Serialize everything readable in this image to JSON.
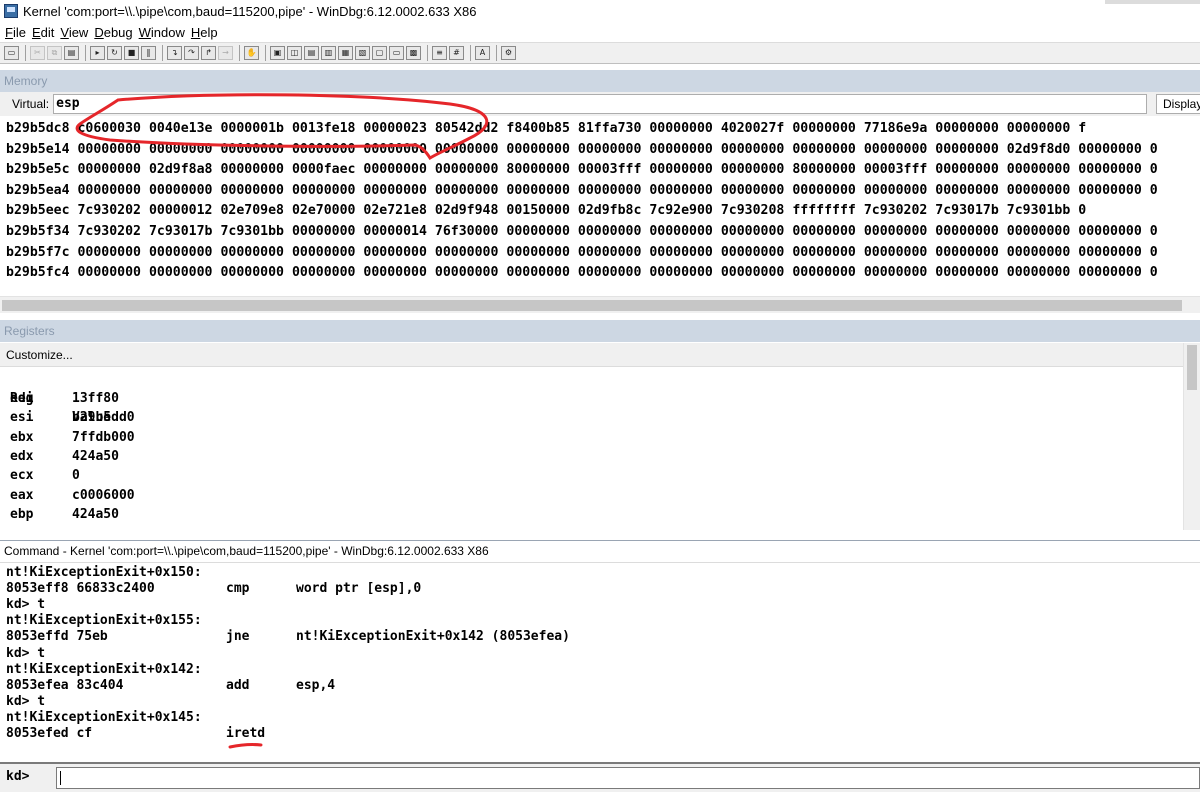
{
  "window": {
    "title": "Kernel 'com:port=\\\\.\\pipe\\com,baud=115200,pipe' - WinDbg:6.12.0002.633 X86"
  },
  "menu": [
    {
      "accel": "F",
      "rest": "ile"
    },
    {
      "accel": "E",
      "rest": "dit"
    },
    {
      "accel": "V",
      "rest": "iew"
    },
    {
      "accel": "D",
      "rest": "ebug"
    },
    {
      "accel": "W",
      "rest": "indow"
    },
    {
      "accel": "H",
      "rest": "elp"
    }
  ],
  "memory": {
    "header": "Memory",
    "virtual_label": "Virtual:",
    "virtual_value": "esp",
    "display_label": "Display",
    "rows": [
      {
        "addr": "b29b5dc8",
        "words": [
          "c0600030",
          "0040e13e",
          "0000001b",
          "0013fe18",
          "00000023",
          "80542dd2",
          "f8400b85",
          "81ffa730",
          "00000000",
          "4020027f",
          "00000000",
          "77186e9a",
          "00000000",
          "00000000",
          "f"
        ]
      },
      {
        "addr": "b29b5e14",
        "words": [
          "00000000",
          "00000000",
          "00000000",
          "00000000",
          "00000000",
          "00000000",
          "00000000",
          "00000000",
          "00000000",
          "00000000",
          "00000000",
          "00000000",
          "00000000",
          "02d9f8d0",
          "00000000",
          "0"
        ]
      },
      {
        "addr": "b29b5e5c",
        "words": [
          "00000000",
          "02d9f8a8",
          "00000000",
          "0000faec",
          "00000000",
          "00000000",
          "80000000",
          "00003fff",
          "00000000",
          "00000000",
          "80000000",
          "00003fff",
          "00000000",
          "00000000",
          "00000000",
          "0"
        ]
      },
      {
        "addr": "b29b5ea4",
        "words": [
          "00000000",
          "00000000",
          "00000000",
          "00000000",
          "00000000",
          "00000000",
          "00000000",
          "00000000",
          "00000000",
          "00000000",
          "00000000",
          "00000000",
          "00000000",
          "00000000",
          "00000000",
          "0"
        ]
      },
      {
        "addr": "b29b5eec",
        "words": [
          "7c930202",
          "00000012",
          "02e709e8",
          "02e70000",
          "02e721e8",
          "02d9f948",
          "00150000",
          "02d9fb8c",
          "7c92e900",
          "7c930208",
          "ffffffff",
          "7c930202",
          "7c93017b",
          "7c9301bb",
          "0"
        ]
      },
      {
        "addr": "b29b5f34",
        "words": [
          "7c930202",
          "7c93017b",
          "7c9301bb",
          "00000000",
          "00000014",
          "76f30000",
          "00000000",
          "00000000",
          "00000000",
          "00000000",
          "00000000",
          "00000000",
          "00000000",
          "00000000",
          "00000000",
          "0"
        ]
      },
      {
        "addr": "b29b5f7c",
        "words": [
          "00000000",
          "00000000",
          "00000000",
          "00000000",
          "00000000",
          "00000000",
          "00000000",
          "00000000",
          "00000000",
          "00000000",
          "00000000",
          "00000000",
          "00000000",
          "00000000",
          "00000000",
          "0"
        ]
      },
      {
        "addr": "b29b5fc4",
        "words": [
          "00000000",
          "00000000",
          "00000000",
          "00000000",
          "00000000",
          "00000000",
          "00000000",
          "00000000",
          "00000000",
          "00000000",
          "00000000",
          "00000000",
          "00000000",
          "00000000",
          "00000000",
          "0"
        ]
      }
    ]
  },
  "registers": {
    "header": "Registers",
    "customize_label": "Customize...",
    "col_reg": "Reg",
    "col_value": "Value",
    "rows": [
      {
        "name": "edi",
        "value": "13ff80"
      },
      {
        "name": "esi",
        "value": "b29b5dd0"
      },
      {
        "name": "ebx",
        "value": "7ffdb000"
      },
      {
        "name": "edx",
        "value": "424a50"
      },
      {
        "name": "ecx",
        "value": "0"
      },
      {
        "name": "eax",
        "value": "c0006000"
      },
      {
        "name": "ebp",
        "value": "424a50"
      }
    ]
  },
  "command": {
    "header": "Command - Kernel 'com:port=\\\\.\\pipe\\com,baud=115200,pipe' - WinDbg:6.12.0002.633 X86",
    "lines": [
      {
        "type": "sym",
        "text": "nt!KiExceptionExit+0x150:"
      },
      {
        "type": "ins",
        "addr": "8053eff8 66833c2400",
        "mnemonic": "cmp",
        "operands": "word ptr [esp],0"
      },
      {
        "type": "prompt",
        "text": "kd> t"
      },
      {
        "type": "sym",
        "text": "nt!KiExceptionExit+0x155:"
      },
      {
        "type": "ins",
        "addr": "8053effd 75eb",
        "mnemonic": "jne",
        "operands": "nt!KiExceptionExit+0x142 (8053efea)"
      },
      {
        "type": "prompt",
        "text": "kd> t"
      },
      {
        "type": "sym",
        "text": "nt!KiExceptionExit+0x142:"
      },
      {
        "type": "ins",
        "addr": "8053efea 83c404",
        "mnemonic": "add",
        "operands": "esp,4"
      },
      {
        "type": "prompt",
        "text": "kd> t"
      },
      {
        "type": "sym",
        "text": "nt!KiExceptionExit+0x145:"
      },
      {
        "type": "ins",
        "addr": "8053efed cf",
        "mnemonic": "iretd",
        "operands": ""
      }
    ],
    "prompt": "kd>"
  },
  "colors": {
    "annotation": "#e5262a",
    "inactive_header": "#cdd7e3"
  }
}
